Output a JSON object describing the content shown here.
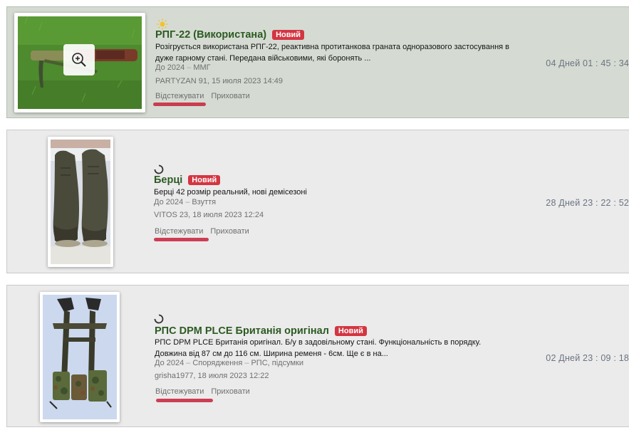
{
  "listings": [
    {
      "title": "РПГ-22 (Використана)",
      "badge": "Новий",
      "status_icon": "sun-icon",
      "snippet": "Розігрується використана РПГ-22, реактивна протитанкова граната одноразового застосування в дуже гарному стані. Передана військовими, які боронять ...",
      "prefix": "До 2024",
      "categories": [
        "ММГ"
      ],
      "author": "PARTYZAN 91, 15 июля 2023 14:49",
      "track_label": "Відстежувати",
      "hide_label": "Приховати",
      "timer": "04 Дней 01 : 45 : 34",
      "image_alt": "rpg-22-photo",
      "featured": true
    },
    {
      "title": "Берці",
      "badge": "Новий",
      "status_icon": "refresh-icon",
      "snippet": "Берці 42 розмір реальний, нові демісезоні",
      "prefix": "До 2024",
      "categories": [
        "Взуття"
      ],
      "author": "VITOS 23, 18 июля 2023 12:24",
      "track_label": "Відстежувати",
      "hide_label": "Приховати",
      "timer": "28 Дней 23 : 22 : 52",
      "image_alt": "boots-photo",
      "featured": false
    },
    {
      "title": "РПС DPM PLCE Британія оригінал",
      "badge": "Новий",
      "status_icon": "refresh-icon",
      "snippet": "РПС DPM PLCE Британія оригінал. Б/у в задовільному стані. Функціональність в порядку. Довжина від 87 см до 116 см. Ширина ременя - 6см. Ще є в на...",
      "prefix": "До 2024",
      "categories": [
        "Спорядження",
        "РПС, підсумки"
      ],
      "author": "grisha1977, 18 июля 2023 12:22",
      "track_label": "Відстежувати",
      "hide_label": "Приховати",
      "timer": "02 Дней 23 : 09 : 18",
      "image_alt": "webbing-photo",
      "featured": false
    }
  ],
  "colors": {
    "title": "#2c5a22",
    "badge": "#d43542",
    "featured_bg": "#d5dbd2",
    "normal_bg": "#ebebeb",
    "underline": "#c8203a"
  }
}
